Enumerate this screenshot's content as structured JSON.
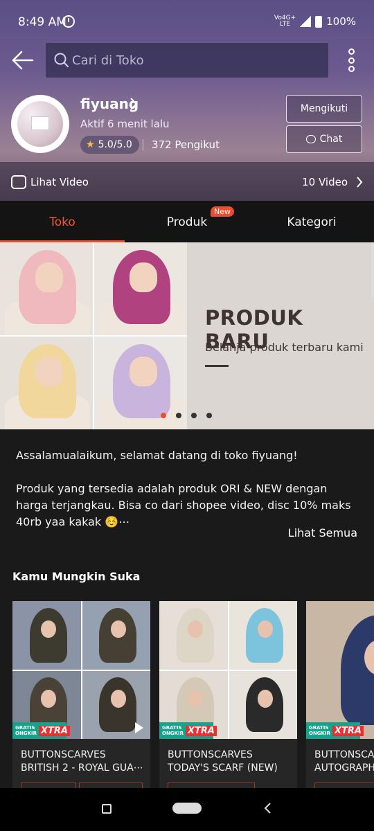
{
  "status": {
    "time": "8:49 AM",
    "network": "VoLTE 4G+",
    "battery": "100%"
  },
  "search": {
    "placeholder": "Cari di Toko"
  },
  "shop": {
    "name": "fiyuang",
    "active": "Aktif 6 menit lalu",
    "rating": "5.0/5.0",
    "followers": "372 Pengikut",
    "follow_label": "Mengikuti",
    "chat_label": "Chat"
  },
  "video": {
    "label": "Lihat Video",
    "count": "10 Video"
  },
  "tabs": [
    {
      "label": "Toko",
      "active": true
    },
    {
      "label": "Produk",
      "badge": "New"
    },
    {
      "label": "Kategori"
    }
  ],
  "banner": {
    "title": "PRODUK BARU",
    "subtitle": "Belanja produk terbaru kami",
    "slides": 4,
    "current_slide": 1
  },
  "description": {
    "line1": "Assalamualaikum, selamat datang di toko fiyuang!",
    "line2": "Produk yang tersedia adalah produk ORI & NEW dengan harga terjangkau. Bisa co dari shopee video, disc 10% maks 40rb yaa kakak ☺️⋯",
    "see_all": "Lihat Semua"
  },
  "recommendations": {
    "title": "Kamu Mungkin Suka",
    "badge": {
      "text": "GRATIS ONGKIR",
      "xtra": "XTRA"
    },
    "items": [
      {
        "name": "BUTTONSCARVES BRITISH 2 - ROYAL GUA⋯",
        "line1": "BUTTONSCARVES",
        "line2": "BRITISH 2 - ROYAL GUA⋯"
      },
      {
        "name": "BUTTONSCARVES TODAY'S SCARF (NEW)",
        "line1": "BUTTONSCARVES",
        "line2": "TODAY'S SCARF (NEW)"
      },
      {
        "name": "BUTTONSCARVES AUTOGRAPH",
        "line1": "BUTTONSCA",
        "line2": "AUTOGRAPH"
      }
    ]
  },
  "colors": {
    "accent": "#ee4d2d",
    "teal": "#15a38b",
    "header": "#6b5a8f"
  }
}
